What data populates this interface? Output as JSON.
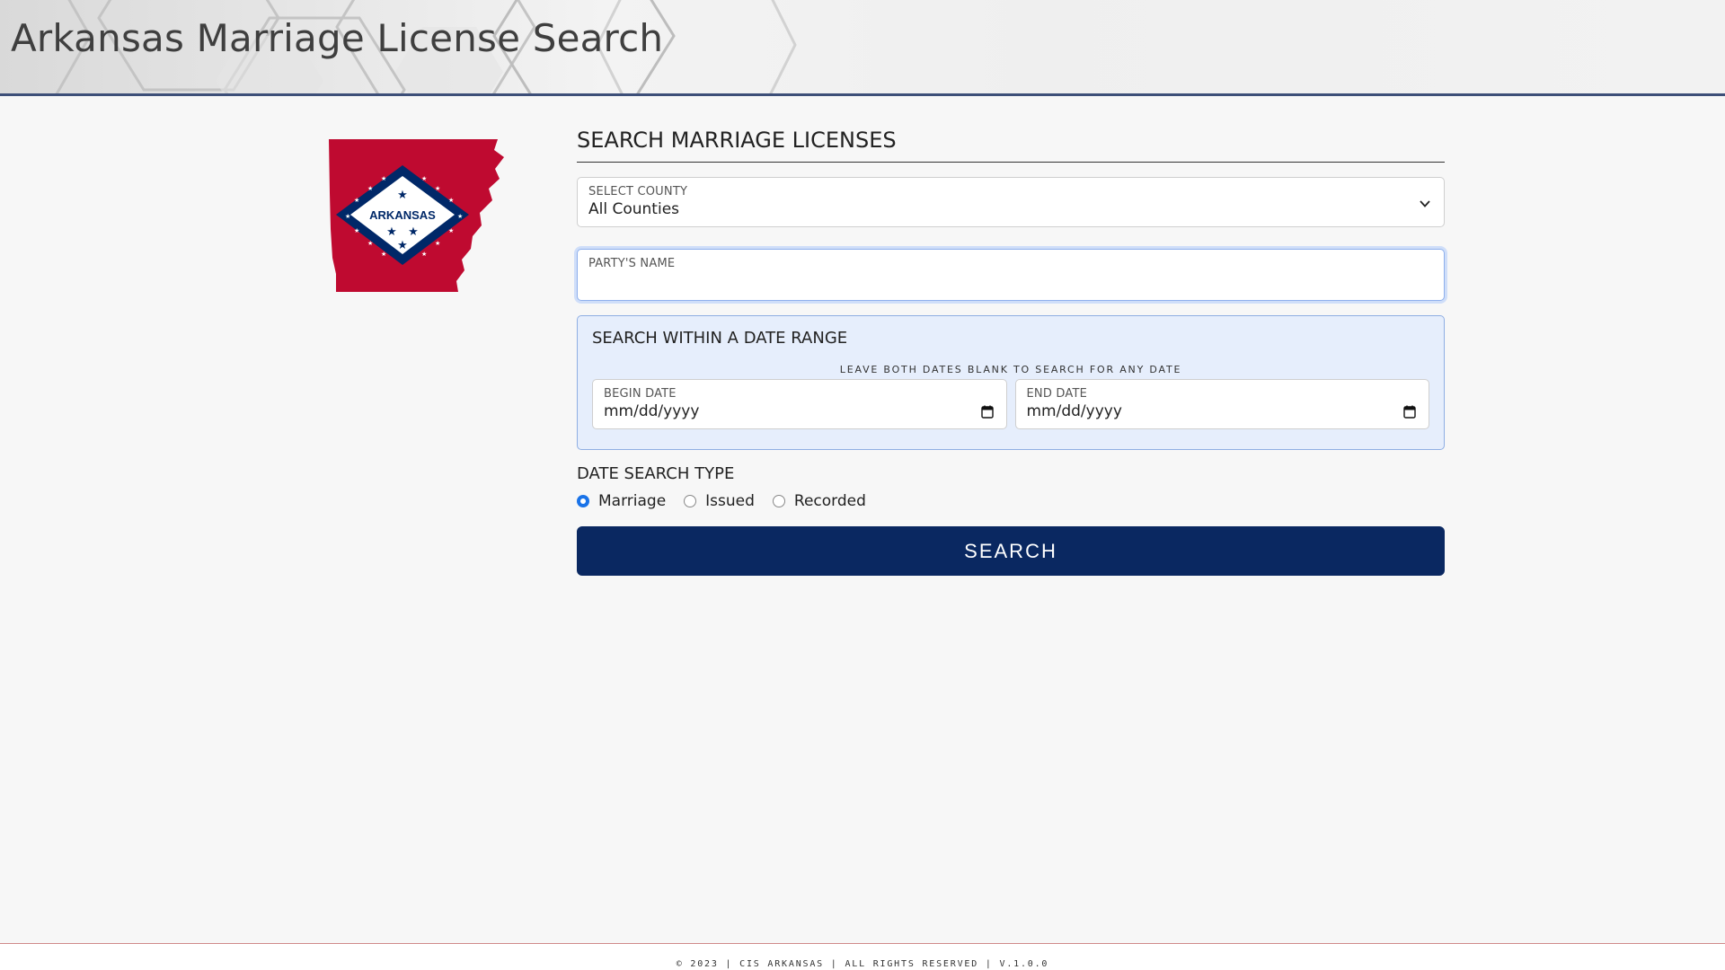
{
  "header": {
    "title": "Arkansas Marriage License Search"
  },
  "logo": {
    "text": "ARKANSAS"
  },
  "form": {
    "heading": "SEARCH MARRIAGE LICENSES",
    "county": {
      "label": "SELECT COUNTY",
      "value": "All Counties"
    },
    "party_name": {
      "label": "PARTY'S NAME",
      "value": ""
    },
    "date_range": {
      "heading": "SEARCH WITHIN A DATE RANGE",
      "hint": "LEAVE BOTH DATES BLANK TO SEARCH FOR ANY DATE",
      "begin": {
        "label": "BEGIN DATE",
        "placeholder": "mm/dd/yyyy"
      },
      "end": {
        "label": "END DATE",
        "placeholder": "mm/dd/yyyy"
      }
    },
    "date_search_type": {
      "heading": "DATE SEARCH TYPE",
      "options": [
        {
          "label": "Marriage",
          "selected": true
        },
        {
          "label": "Issued",
          "selected": false
        },
        {
          "label": "Recorded",
          "selected": false
        }
      ]
    },
    "search_label": "SEARCH"
  },
  "footer": {
    "text": "© 2023 | CIS ARKANSAS | ALL RIGHTS RESERVED | V.1.0.0"
  },
  "colors": {
    "header_border": "#3d4f78",
    "button_bg": "#0a2861",
    "radio_selected": "#1a73e8",
    "date_panel_bg": "#e6eefc",
    "flag_red": "#bf0a30",
    "flag_blue": "#002868"
  }
}
